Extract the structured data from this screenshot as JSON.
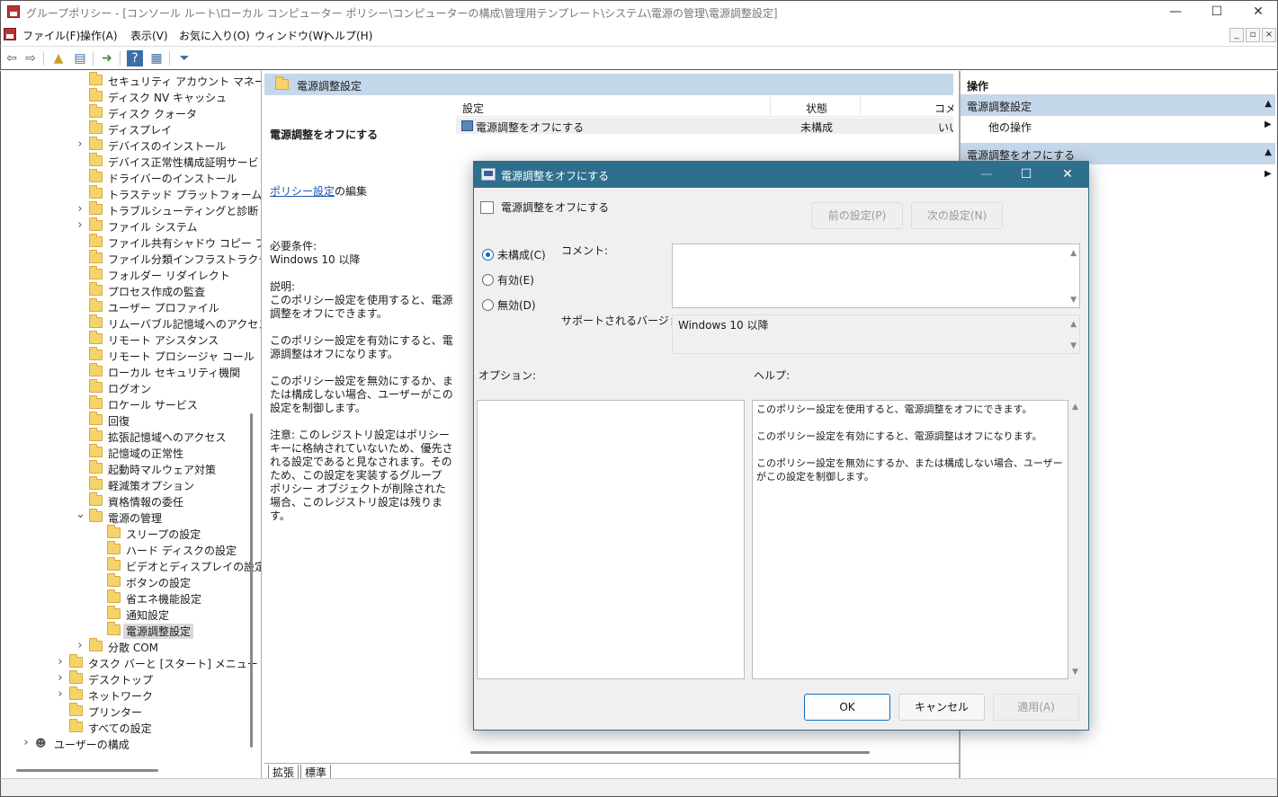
{
  "window": {
    "title": "グループポリシー - [コンソール ルート\\ローカル コンピューター ポリシー\\コンピューターの構成\\管理用テンプレート\\システム\\電源の管理\\電源調整設定]",
    "min": "—",
    "max": "☐",
    "close": "✕"
  },
  "menubar": {
    "items": [
      "ファイル(F)",
      "操作(A)",
      "表示(V)",
      "お気に入り(O)",
      "ウィンドウ(W)",
      "ヘルプ(H)"
    ],
    "mdi_min": "_",
    "mdi_restore": "▫",
    "mdi_close": "×"
  },
  "tree": {
    "items": [
      {
        "label": "セキュリティ アカウント マネージャー",
        "level": 2,
        "expander": ""
      },
      {
        "label": "ディスク NV キャッシュ",
        "level": 2,
        "expander": ""
      },
      {
        "label": "ディスク クォータ",
        "level": 2,
        "expander": ""
      },
      {
        "label": "ディスプレイ",
        "level": 2,
        "expander": ""
      },
      {
        "label": "デバイスのインストール",
        "level": 2,
        "expander": ">"
      },
      {
        "label": "デバイス正常性構成証明サービ",
        "level": 2,
        "expander": ""
      },
      {
        "label": "ドライバーのインストール",
        "level": 2,
        "expander": ""
      },
      {
        "label": "トラステッド プラットフォーム モジュー",
        "level": 2,
        "expander": ""
      },
      {
        "label": "トラブルシューティングと診断",
        "level": 2,
        "expander": ">"
      },
      {
        "label": "ファイル システム",
        "level": 2,
        "expander": ">"
      },
      {
        "label": "ファイル共有シャドウ コピー プロバ",
        "level": 2,
        "expander": ""
      },
      {
        "label": "ファイル分類インフラストラクチャ",
        "level": 2,
        "expander": ""
      },
      {
        "label": "フォルダー リダイレクト",
        "level": 2,
        "expander": ""
      },
      {
        "label": "プロセス作成の監査",
        "level": 2,
        "expander": ""
      },
      {
        "label": "ユーザー プロファイル",
        "level": 2,
        "expander": ""
      },
      {
        "label": "リムーバブル記憶域へのアクセス",
        "level": 2,
        "expander": ""
      },
      {
        "label": "リモート アシスタンス",
        "level": 2,
        "expander": ""
      },
      {
        "label": "リモート プロシージャ コール",
        "level": 2,
        "expander": ""
      },
      {
        "label": "ローカル セキュリティ機関",
        "level": 2,
        "expander": ""
      },
      {
        "label": "ログオン",
        "level": 2,
        "expander": ""
      },
      {
        "label": "ロケール サービス",
        "level": 2,
        "expander": ""
      },
      {
        "label": "回復",
        "level": 2,
        "expander": ""
      },
      {
        "label": "拡張記憶域へのアクセス",
        "level": 2,
        "expander": ""
      },
      {
        "label": "記憶域の正常性",
        "level": 2,
        "expander": ""
      },
      {
        "label": "起動時マルウェア対策",
        "level": 2,
        "expander": ""
      },
      {
        "label": "軽減策オプション",
        "level": 2,
        "expander": ""
      },
      {
        "label": "資格情報の委任",
        "level": 2,
        "expander": ""
      },
      {
        "label": "電源の管理",
        "level": 2,
        "expander": "v"
      },
      {
        "label": "スリープの設定",
        "level": 3,
        "expander": ""
      },
      {
        "label": "ハード ディスクの設定",
        "level": 3,
        "expander": ""
      },
      {
        "label": "ビデオとディスプレイの設定",
        "level": 3,
        "expander": ""
      },
      {
        "label": "ボタンの設定",
        "level": 3,
        "expander": ""
      },
      {
        "label": "省エネ機能設定",
        "level": 3,
        "expander": ""
      },
      {
        "label": "通知設定",
        "level": 3,
        "expander": ""
      },
      {
        "label": "電源調整設定",
        "level": 3,
        "expander": "",
        "selected": true
      },
      {
        "label": "分散 COM",
        "level": 2,
        "expander": ">"
      },
      {
        "label": "タスク バーと [スタート] メニュー",
        "level": 1,
        "expander": ">"
      },
      {
        "label": "デスクトップ",
        "level": 1,
        "expander": ">"
      },
      {
        "label": "ネットワーク",
        "level": 1,
        "expander": ">"
      },
      {
        "label": "プリンター",
        "level": 1,
        "expander": ""
      },
      {
        "label": "すべての設定",
        "level": 1,
        "expander": "",
        "icon": "settings"
      },
      {
        "label": "ユーザーの構成",
        "level": 0,
        "expander": ">",
        "icon": "user"
      }
    ]
  },
  "middle": {
    "header": "電源調整設定",
    "desc_title": "電源調整をオフにする",
    "desc_link": "ポリシー設定",
    "desc_link_suffix": "の編集",
    "desc_body": "必要条件:\nWindows 10 以降\n\n説明:\nこのポリシー設定を使用すると、電源調整をオフにできます。\n\nこのポリシー設定を有効にすると、電源調整はオフになります。\n\nこのポリシー設定を無効にするか、または構成しない場合、ユーザーがこの設定を制御します。\n\n注意: このレジストリ設定はポリシー キーに格納されていないため、優先される設定であると見なされます。そのため、この設定を実装するグループ ポリシー オブジェクトが削除された場合、このレジストリ設定は残ります。",
    "columns": [
      "設定",
      "状態",
      "コメン"
    ],
    "rows": [
      {
        "name": "電源調整をオフにする",
        "state": "未構成",
        "comment": "いい"
      }
    ],
    "tabs": [
      "拡張",
      "標準"
    ]
  },
  "actions": {
    "header": "操作",
    "section1": "電源調整設定",
    "item1": "他の操作",
    "section2": "電源調整をオフにする"
  },
  "dialog": {
    "title": "電源調整をオフにする",
    "policy_name": "電源調整をオフにする",
    "prev_button": "前の設定(P)",
    "next_button": "次の設定(N)",
    "options": [
      {
        "label": "未構成(C)",
        "checked": true
      },
      {
        "label": "有効(E)",
        "checked": false
      },
      {
        "label": "無効(D)",
        "checked": false
      }
    ],
    "comment_label": "コメント:",
    "comment_value": "",
    "supported_label": "サポートされるバージョン:",
    "supported_value": "Windows 10 以降",
    "options_label": "オプション:",
    "help_label": "ヘルプ:",
    "help_text": "このポリシー設定を使用すると、電源調整をオフにできます。\n\nこのポリシー設定を有効にすると、電源調整はオフになります。\n\nこのポリシー設定を無効にするか、または構成しない場合、ユーザーがこの設定を制御します。",
    "ok": "OK",
    "cancel": "キャンセル",
    "apply": "適用(A)",
    "min": "—",
    "max": "☐",
    "close": "✕"
  },
  "colors": {
    "title_bar": "#2e6f8e",
    "header_band": "#c5d7ea",
    "accent": "#0f6cbd"
  }
}
